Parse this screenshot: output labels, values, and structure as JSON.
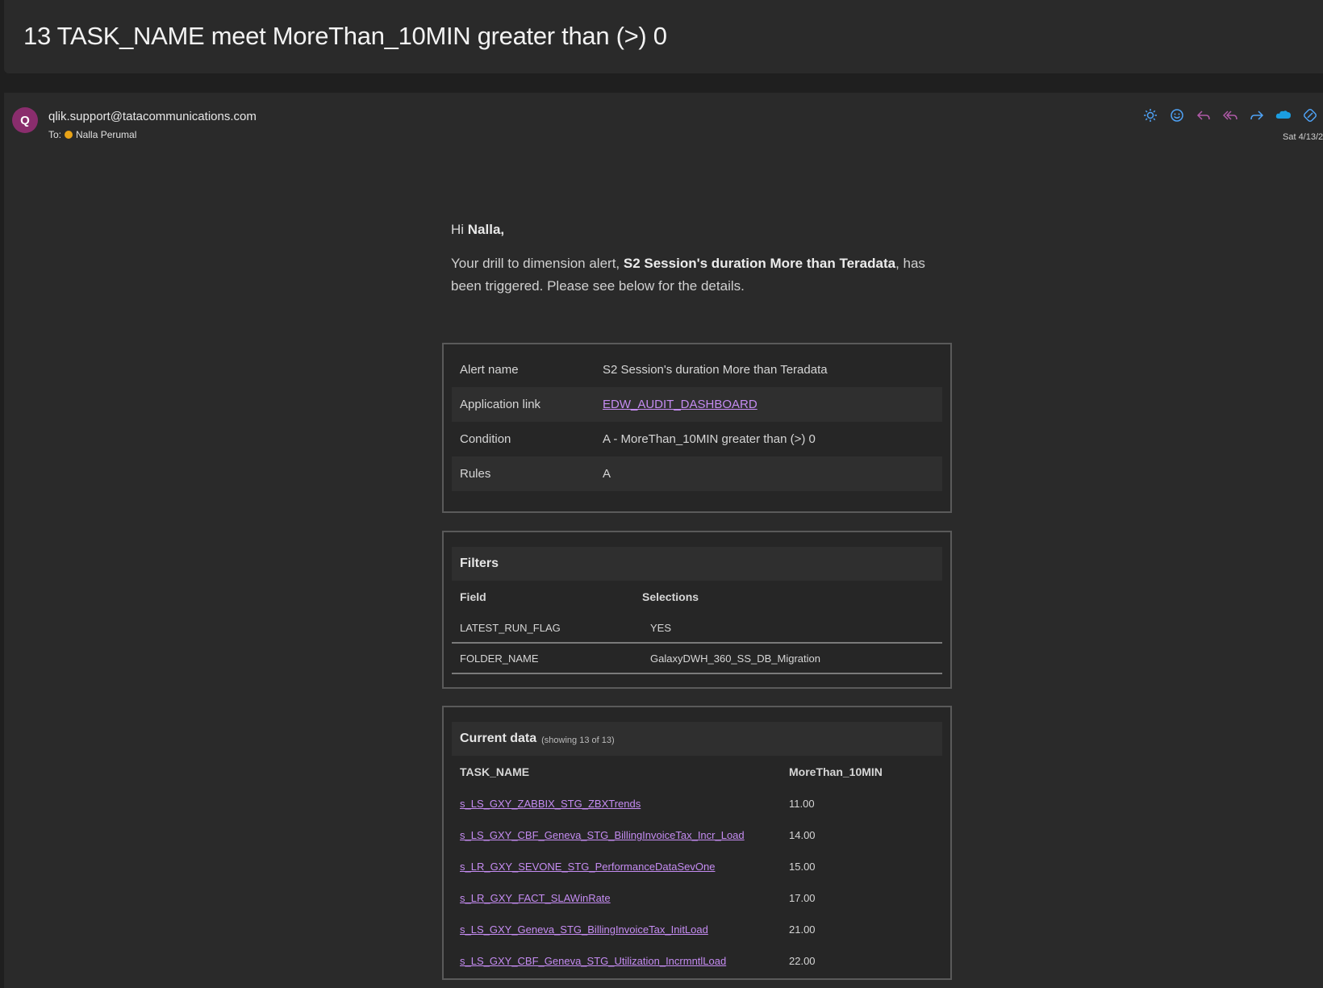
{
  "subject": "13 TASK_NAME meet MoreThan_10MIN greater than (>) 0",
  "header": {
    "avatar_letter": "Q",
    "sender": "qlik.support@tatacommunications.com",
    "to_label": "To:",
    "recipient": "Nalla Perumal",
    "date": "Sat 4/13/2",
    "toolbar_icons": [
      "sun-icon",
      "emoji-icon",
      "reply-icon",
      "reply-all-icon",
      "forward-icon",
      "salesforce-icon",
      "link-icon"
    ]
  },
  "body": {
    "greeting_prefix": "Hi ",
    "greeting_name": "Nalla,",
    "intro_prefix": "Your drill to dimension alert, ",
    "intro_alert": "S2 Session's duration More than Teradata",
    "intro_suffix": ", has been triggered. Please see below for the details."
  },
  "alert_details": [
    {
      "key": "Alert name",
      "value": "S2 Session's duration More than Teradata"
    },
    {
      "key": "Application link",
      "value": "EDW_AUDIT_DASHBOARD"
    },
    {
      "key": "Condition",
      "value": "A - MoreThan_10MIN greater than (>) 0"
    },
    {
      "key": "Rules",
      "value": "A"
    }
  ],
  "filters": {
    "title": "Filters",
    "col_field": "Field",
    "col_selections": "Selections",
    "rows": [
      {
        "field": "LATEST_RUN_FLAG",
        "selection": "YES"
      },
      {
        "field": "FOLDER_NAME",
        "selection": "GalaxyDWH_360_SS_DB_Migration"
      }
    ]
  },
  "current_data": {
    "title": "Current data",
    "subtitle": "(showing 13 of 13)",
    "col_task": "TASK_NAME",
    "col_value": "MoreThan_10MIN",
    "rows": [
      {
        "task": "s_LS_GXY_ZABBIX_STG_ZBXTrends",
        "value": "11.00"
      },
      {
        "task": "s_LS_GXY_CBF_Geneva_STG_BillingInvoiceTax_Incr_Load",
        "value": "14.00"
      },
      {
        "task": "s_LR_GXY_SEVONE_STG_PerformanceDataSevOne",
        "value": "15.00"
      },
      {
        "task": "s_LR_GXY_FACT_SLAWinRate",
        "value": "17.00"
      },
      {
        "task": "s_LS_GXY_Geneva_STG_BillingInvoiceTax_InitLoad",
        "value": "21.00"
      },
      {
        "task": "s_LS_GXY_CBF_Geneva_STG_Utilization_IncrmntlLoad",
        "value": "22.00"
      }
    ]
  }
}
